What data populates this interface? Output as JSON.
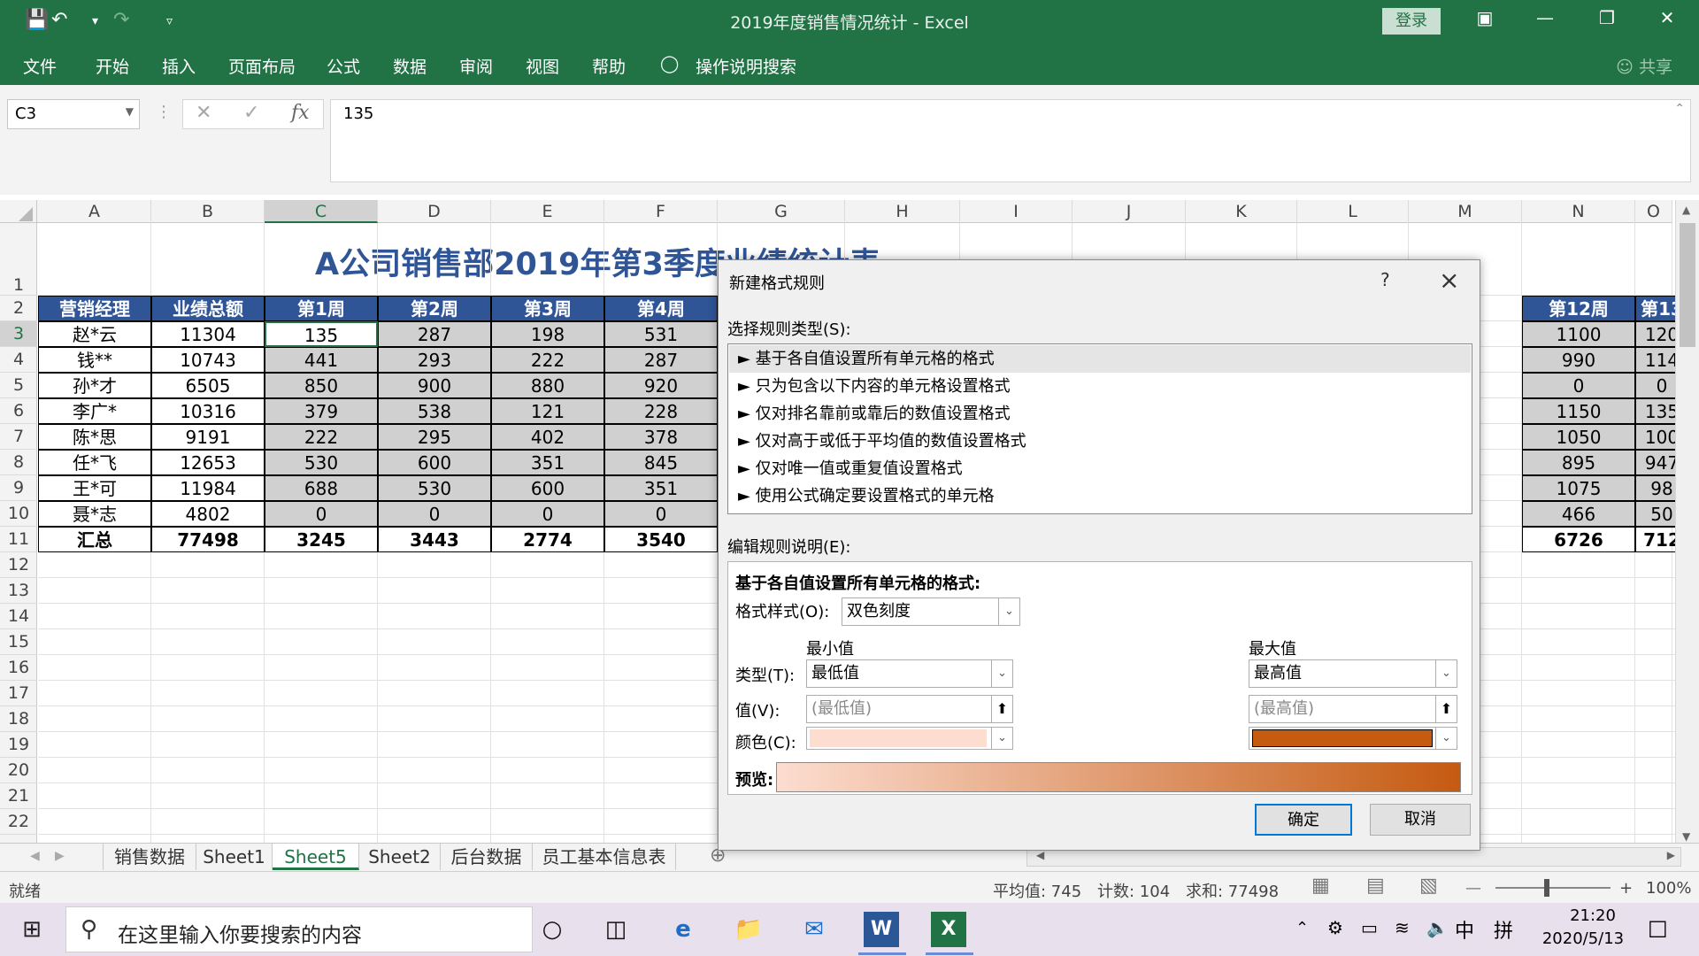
{
  "titlebar": {
    "doc_title": "2019年度销售情况统计  -  Excel",
    "login": "登录",
    "colors": {
      "ribbon": "#217346"
    }
  },
  "ribbon_tabs": [
    "文件",
    "开始",
    "插入",
    "页面布局",
    "公式",
    "数据",
    "审阅",
    "视图",
    "帮助"
  ],
  "tell_me": "操作说明搜索",
  "share": "共享",
  "formula_bar": {
    "name_box": "C3",
    "value": "135"
  },
  "columns": [
    "A",
    "B",
    "C",
    "D",
    "E",
    "F",
    "G",
    "H",
    "I",
    "J",
    "K",
    "L",
    "M",
    "N",
    "O"
  ],
  "rows": [
    "1",
    "2",
    "3",
    "4",
    "5",
    "6",
    "7",
    "8",
    "9",
    "10",
    "11",
    "12",
    "13",
    "14",
    "15",
    "16",
    "17",
    "18",
    "19",
    "20",
    "21",
    "22"
  ],
  "sheet": {
    "title": "A公司销售部2019年第3季度业绩统计表",
    "headers": [
      "营销经理",
      "业绩总额",
      "第1周",
      "第2周",
      "第3周",
      "第4周",
      "第12周",
      "第13"
    ],
    "data_rows": [
      [
        "赵*云",
        "11304",
        "135",
        "287",
        "198",
        "531",
        "1100",
        "120"
      ],
      [
        "钱**",
        "10743",
        "441",
        "293",
        "222",
        "287",
        "990",
        "114"
      ],
      [
        "孙*才",
        "6505",
        "850",
        "900",
        "880",
        "920",
        "0",
        "0"
      ],
      [
        "李广*",
        "10316",
        "379",
        "538",
        "121",
        "228",
        "1150",
        "135"
      ],
      [
        "陈*思",
        "9191",
        "222",
        "295",
        "402",
        "378",
        "1050",
        "100"
      ],
      [
        "任*飞",
        "12653",
        "530",
        "600",
        "351",
        "845",
        "895",
        "947"
      ],
      [
        "王*可",
        "11984",
        "688",
        "530",
        "600",
        "351",
        "1075",
        "98"
      ],
      [
        "聂*志",
        "4802",
        "0",
        "0",
        "0",
        "0",
        "466",
        "50"
      ]
    ],
    "total_row": [
      "汇总",
      "77498",
      "3245",
      "3443",
      "2774",
      "3540",
      "6726",
      "712"
    ]
  },
  "sheet_tabs": [
    "销售数据",
    "Sheet1",
    "Sheet5",
    "Sheet2",
    "后台数据",
    "员工基本信息表"
  ],
  "active_sheet": "Sheet5",
  "status": {
    "ready": "就绪",
    "average": "平均值: 745",
    "count": "计数: 104",
    "sum": "求和: 77498",
    "zoom": "100%"
  },
  "taskbar": {
    "search_placeholder": "在这里输入你要搜索的内容",
    "time": "21:20",
    "date": "2020/5/13",
    "ime_lang": "中",
    "ime_mode": "拼"
  },
  "dialog": {
    "title": "新建格式规则",
    "help": "?",
    "select_rule_label": "选择规则类型(S):",
    "rule_types": [
      "► 基于各自值设置所有单元格的格式",
      "► 只为包含以下内容的单元格设置格式",
      "► 仅对排名靠前或靠后的数值设置格式",
      "► 仅对高于或低于平均值的数值设置格式",
      "► 仅对唯一值或重复值设置格式",
      "► 使用公式确定要设置格式的单元格"
    ],
    "edit_label": "编辑规则说明(E):",
    "edit_heading": "基于各自值设置所有单元格的格式:",
    "format_style_label": "格式样式(O):",
    "format_style": "双色刻度",
    "min_label": "最小值",
    "max_label": "最大值",
    "type_label": "类型(T):",
    "value_label": "值(V):",
    "color_label": "颜色(C):",
    "min_type": "最低值",
    "max_type": "最高值",
    "min_value_placeholder": "(最低值)",
    "max_value_placeholder": "(最高值)",
    "min_color": "#fcddd0",
    "max_color": "#c55a11",
    "preview_label": "预览:",
    "ok": "确定",
    "cancel": "取消"
  }
}
